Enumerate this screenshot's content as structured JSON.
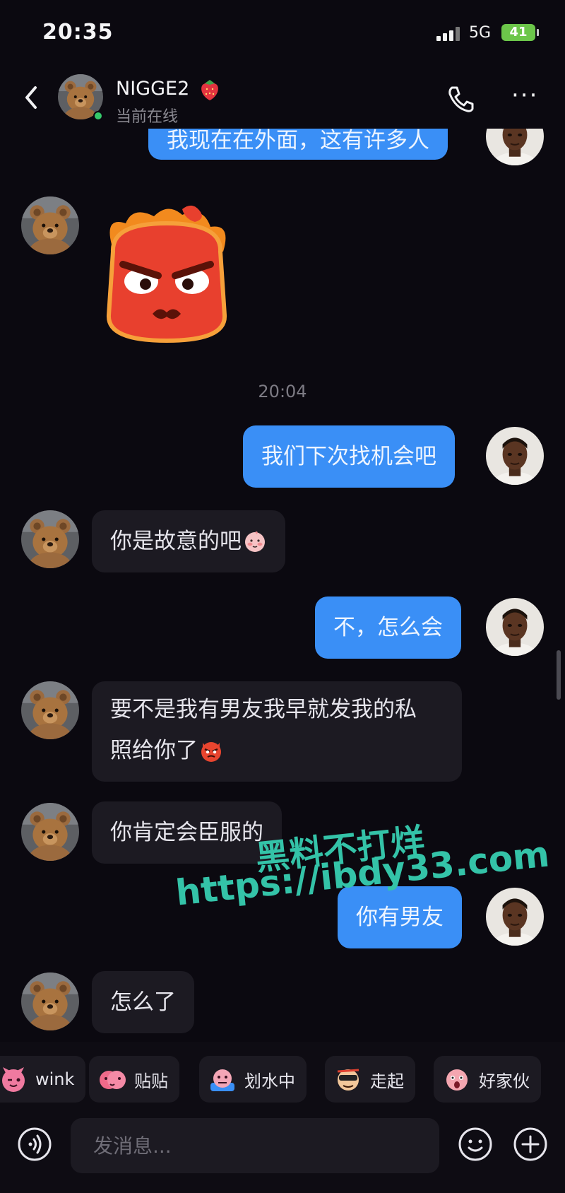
{
  "status_bar": {
    "time": "20:35",
    "network": "5G",
    "battery": "41"
  },
  "header": {
    "contact_name": "NIGGE2",
    "contact_status": "当前在线",
    "name_emoji": "strawberry-icon"
  },
  "chat": {
    "messages": [
      {
        "side": "out",
        "text": "我现在在外面，这有许多人"
      },
      {
        "side": "in",
        "type": "sticker",
        "sticker": "angry-red-blob-sticker"
      },
      {
        "type": "time",
        "text": "20:04"
      },
      {
        "side": "out",
        "text": "我们下次找机会吧"
      },
      {
        "side": "in",
        "text": "你是故意的吧",
        "emoji": "shy-face-emoji"
      },
      {
        "side": "out",
        "text": "不，怎么会"
      },
      {
        "side": "in",
        "line1": "要不是我有男友我早就发我的私",
        "line2": "照给你了",
        "emoji": "devil-face-emoji"
      },
      {
        "side": "in",
        "text": "你肯定会臣服的"
      },
      {
        "side": "out",
        "text": "你有男友"
      },
      {
        "side": "in",
        "text": "怎么了"
      }
    ]
  },
  "watermark": {
    "line1": "黑料不打烊",
    "line2": "https://ibdy33.com"
  },
  "sticker_bar": {
    "items": [
      {
        "label": "wink",
        "icon": "wink-sticker-icon"
      },
      {
        "label": "贴贴",
        "icon": "hug-sticker-icon"
      },
      {
        "label": "划水中",
        "icon": "slacking-sticker-icon"
      },
      {
        "label": "走起",
        "icon": "lets-go-sticker-icon"
      },
      {
        "label": "好家伙",
        "icon": "wow-sticker-icon"
      }
    ]
  },
  "input_bar": {
    "placeholder": "发消息..."
  },
  "colors": {
    "outgoing_bubble": "#3a8ff6",
    "incoming_bubble": "#1c1a22",
    "background": "#0b0910",
    "online": "#35c86a",
    "watermark": "#34c3a8"
  }
}
